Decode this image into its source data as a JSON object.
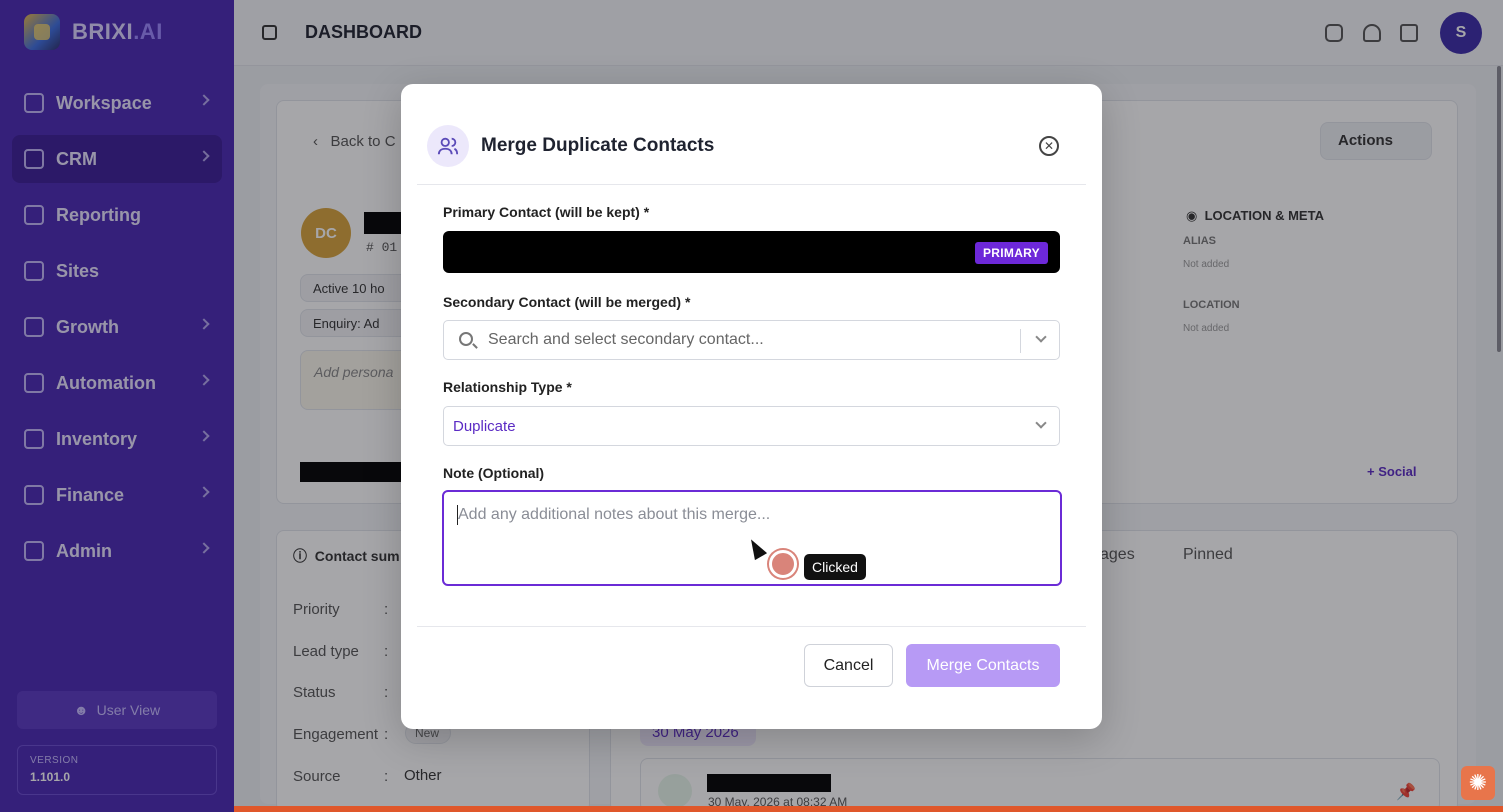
{
  "brand": {
    "name": "BRIXI",
    "suffix": ".AI"
  },
  "sidebar": {
    "items": [
      {
        "label": "Workspace",
        "icon": "grid-icon",
        "active": false
      },
      {
        "label": "CRM",
        "icon": "users-icon",
        "active": true
      },
      {
        "label": "Reporting",
        "icon": "bar-chart-icon",
        "active": false
      },
      {
        "label": "Sites",
        "icon": "globe-icon",
        "active": false
      },
      {
        "label": "Growth",
        "icon": "trending-up-icon",
        "active": false
      },
      {
        "label": "Automation",
        "icon": "lightning-icon",
        "active": false
      },
      {
        "label": "Inventory",
        "icon": "box-icon",
        "active": false
      },
      {
        "label": "Finance",
        "icon": "dollar-icon",
        "active": false
      },
      {
        "label": "Admin",
        "icon": "shield-icon",
        "active": false
      }
    ],
    "user_view": "User View",
    "version_label": "VERSION",
    "version_value": "1.101.0"
  },
  "topbar": {
    "title": "DASHBOARD",
    "avatar_letter": "S"
  },
  "background": {
    "back_label": "Back to C",
    "actions_label": "Actions",
    "avatar_initials": "DC",
    "id_prefix": "# 01",
    "active_label": "Active 10 ho",
    "enquiry_label": "Enquiry:  Ad",
    "note_placeholder": "Add persona",
    "location_meta": "LOCATION & META",
    "alias_label": "ALIAS",
    "alias_value": "Not added",
    "location_label": "LOCATION",
    "location_value": "Not added",
    "social_label": "+ Social",
    "contact_summary": "Contact sum",
    "tabs_partial": [
      "ages",
      "Pinned"
    ],
    "summary_rows": [
      {
        "label": "Priority",
        "value": ""
      },
      {
        "label": "Lead type",
        "value": ""
      },
      {
        "label": "Status",
        "value": ""
      },
      {
        "label": "Engagement",
        "value": "New"
      },
      {
        "label": "Source",
        "value": "Other"
      }
    ],
    "date_badge": "30 May 2026",
    "timeline_time": "30 May, 2026 at 08:32 AM"
  },
  "modal": {
    "title": "Merge Duplicate Contacts",
    "primary_label": "Primary Contact (will be kept) *",
    "primary_badge": "PRIMARY",
    "secondary_label": "Secondary Contact (will be merged) *",
    "secondary_placeholder": "Search and select secondary contact...",
    "relationship_label": "Relationship Type *",
    "relationship_value": "Duplicate",
    "note_label": "Note (Optional)",
    "note_placeholder": "Add any additional notes about this merge...",
    "cancel_label": "Cancel",
    "merge_label": "Merge Contacts"
  },
  "click_indicator": {
    "label": "Clicked"
  },
  "colors": {
    "sidebar": "#4a27b3",
    "accent": "#6d28d9",
    "merge_disabled": "#b79af5"
  }
}
